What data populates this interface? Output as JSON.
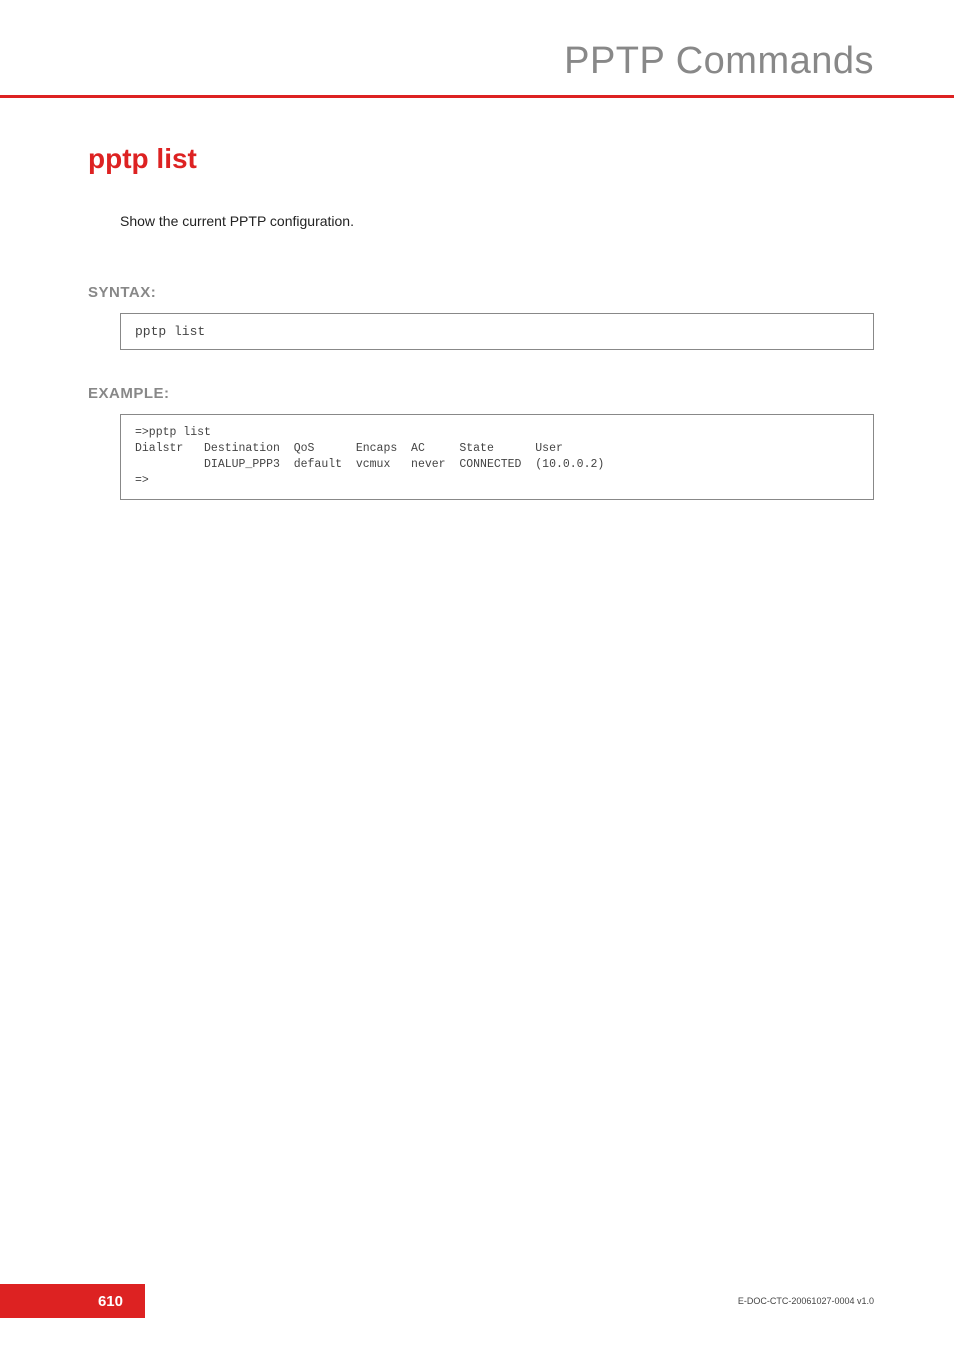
{
  "header": {
    "title": "PPTP Commands"
  },
  "command": {
    "title": "pptp list",
    "description": "Show the current PPTP configuration."
  },
  "syntax": {
    "label": "SYNTAX:",
    "code": "pptp list"
  },
  "example": {
    "label": "EXAMPLE:",
    "output": "=>pptp list\nDialstr   Destination  QoS      Encaps  AC     State      User\n          DIALUP_PPP3  default  vcmux   never  CONNECTED  (10.0.0.2)\n=>"
  },
  "footer": {
    "page": "610",
    "docid": "E-DOC-CTC-20061027-0004 v1.0"
  }
}
